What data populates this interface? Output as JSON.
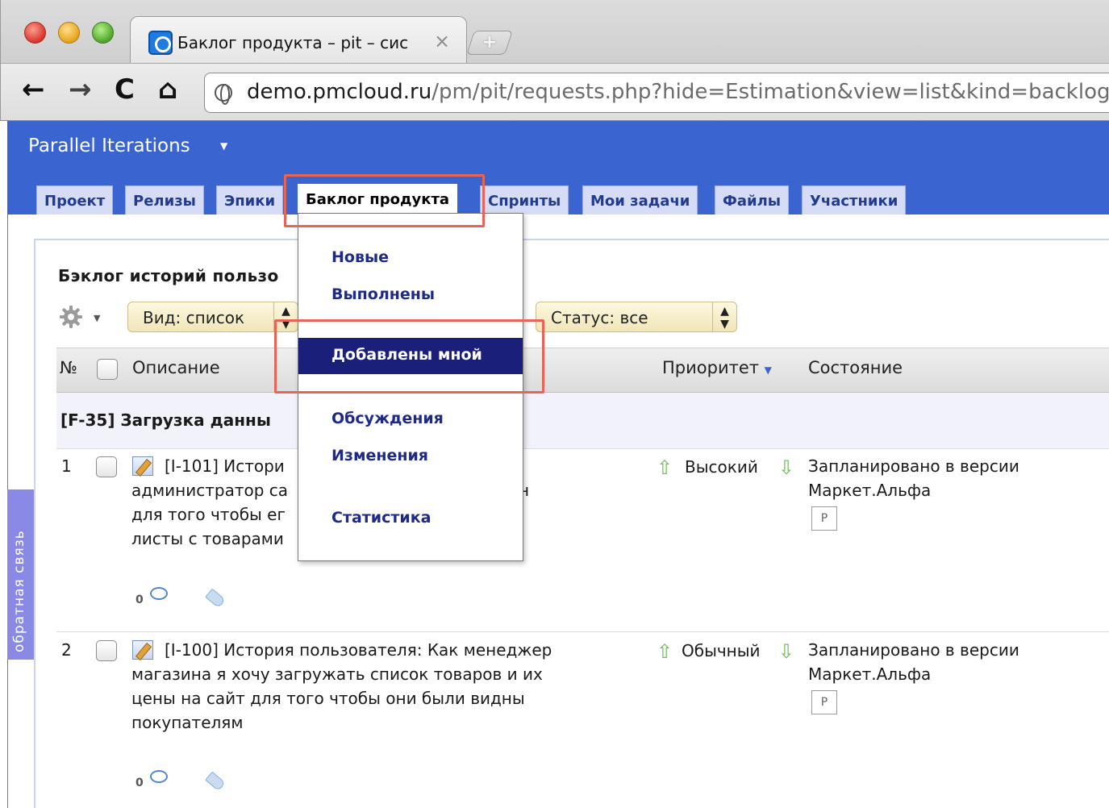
{
  "browser": {
    "tab_title": "Баклог продукта – pit – сис",
    "tab_close": "×",
    "new_tab": "+",
    "url_host": "demo.pmcloud.ru",
    "url_rest": "/pm/pit/requests.php?hide=Estimation&view=list&kind=backlog"
  },
  "app": {
    "project_name": "Parallel Iterations",
    "tabs": [
      "Проект",
      "Релизы",
      "Эпики",
      "Баклог продукта",
      "Спринты",
      "Мои задачи",
      "Файлы",
      "Участники"
    ],
    "active_tab": "Баклог продукта"
  },
  "feedback_label": "обратная связь",
  "board": {
    "title": "Бэклог историй пользо",
    "view_select": "Вид: список",
    "status_select": "Статус: все"
  },
  "table": {
    "columns": {
      "num": "№",
      "description": "Описание",
      "priority": "Приоритет",
      "state": "Состояние"
    },
    "group_label": "[F-35] Загрузка данны",
    "rows": [
      {
        "num": "1",
        "desc_line1": "[I-101] Истори",
        "desc_rest": "администратор са                          вый магазин\nдля того чтобы ег                          ать прайс-\nлисты с товарами                           жи",
        "priority": "Высокий",
        "state_line1": "Запланировано в версии",
        "state_line2": "Маркет.Альфа",
        "badge": "P",
        "comments": "0"
      },
      {
        "num": "2",
        "desc_line1": "[I-100] История пользователя: Как менеджер",
        "desc_rest": "магазина я хочу загружать список товаров и их\nцены на сайт для того чтобы они были видны\nпокупателям",
        "priority": "Обычный",
        "state_line1": "Запланировано в версии",
        "state_line2": "Маркет.Альфа",
        "badge": "P",
        "comments": "0"
      }
    ]
  },
  "dropdown": {
    "items": [
      "Новые",
      "Выполнены",
      "Добавлены мной",
      "Обсуждения",
      "Изменения",
      "Статистика"
    ],
    "selected": "Добавлены мной"
  },
  "colors": {
    "header_blue": "#3a64cf",
    "dropdown_selected": "#1a1f7a",
    "callout": "#e66559",
    "feedback": "#8a8ae6"
  }
}
